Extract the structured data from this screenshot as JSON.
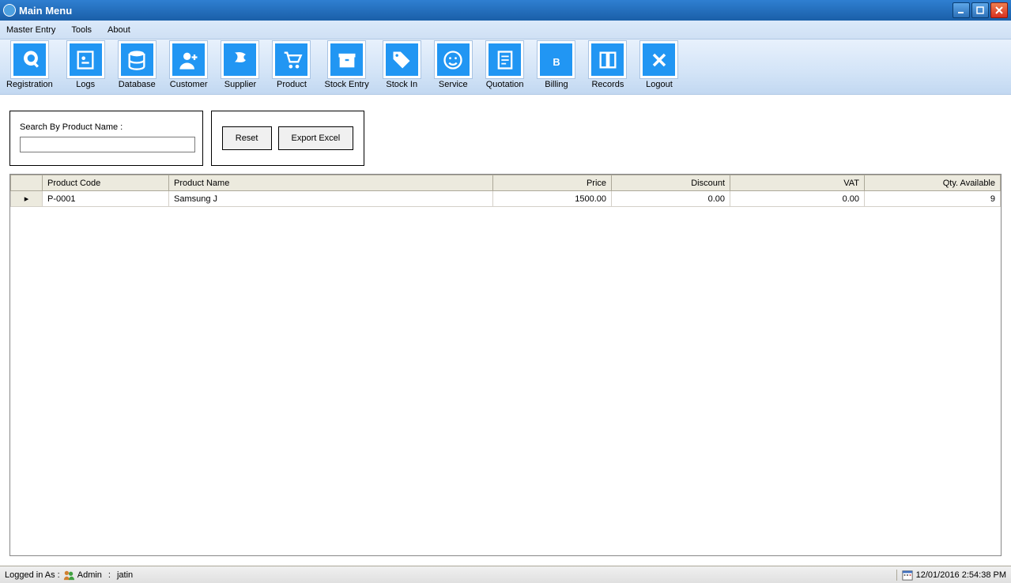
{
  "window": {
    "title": "Main Menu"
  },
  "menu": {
    "items": [
      "Master Entry",
      "Tools",
      "About"
    ]
  },
  "toolbar": {
    "items": [
      {
        "id": "registration",
        "label": "Registration"
      },
      {
        "id": "logs",
        "label": "Logs"
      },
      {
        "id": "database",
        "label": "Database"
      },
      {
        "id": "customer",
        "label": "Customer"
      },
      {
        "id": "supplier",
        "label": "Supplier"
      },
      {
        "id": "product",
        "label": "Product"
      },
      {
        "id": "stock-entry",
        "label": "Stock Entry"
      },
      {
        "id": "stock-in",
        "label": "Stock In"
      },
      {
        "id": "service",
        "label": "Service"
      },
      {
        "id": "quotation",
        "label": "Quotation"
      },
      {
        "id": "billing",
        "label": "Billing"
      },
      {
        "id": "records",
        "label": "Records"
      },
      {
        "id": "logout",
        "label": "Logout"
      }
    ]
  },
  "search": {
    "label": "Search By Product Name :",
    "value": ""
  },
  "actions": {
    "reset": "Reset",
    "export": "Export Excel"
  },
  "grid": {
    "columns": [
      "Product Code",
      "Product Name",
      "Price",
      "Discount",
      "VAT",
      "Qty. Available"
    ],
    "rows": [
      {
        "code": "P-0001",
        "name": "Samsung J",
        "price": "1500.00",
        "discount": "0.00",
        "vat": "0.00",
        "qty": "9"
      }
    ]
  },
  "status": {
    "logged_prefix": "Logged in As :",
    "admin_label": "Admin",
    "separator": ":",
    "user": "jatin",
    "datetime": "12/01/2016 2:54:38 PM"
  }
}
